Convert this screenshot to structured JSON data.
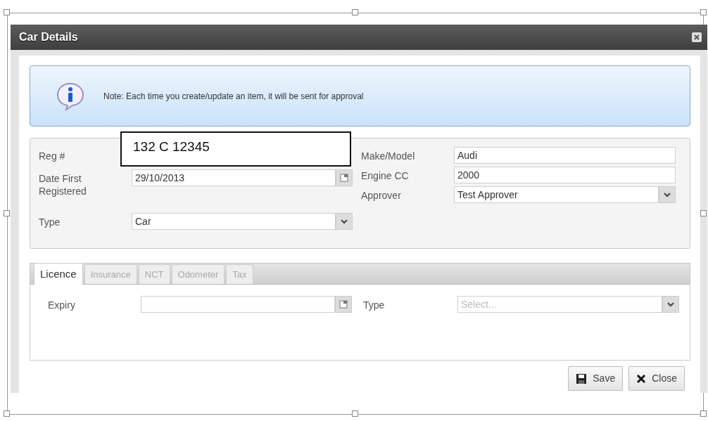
{
  "window": {
    "title": "Car Details"
  },
  "note": {
    "text": "Note: Each time you create/update an item, it will be sent for approval"
  },
  "fields_left": [
    {
      "kind": "text",
      "label": "Reg #",
      "value": "132 C 12345"
    },
    {
      "kind": "date",
      "label": "Date First Registered",
      "value": "29/10/2013"
    },
    {
      "kind": "select",
      "label": "Type",
      "value": "Car"
    }
  ],
  "fields_right": [
    {
      "kind": "text",
      "label": "Make/Model",
      "value": "Audi"
    },
    {
      "kind": "text",
      "label": "Engine CC",
      "value": "2000"
    },
    {
      "kind": "select",
      "label": "Approver",
      "value": "Test Approver"
    }
  ],
  "tabs": [
    {
      "label": "Licence",
      "selected": true
    },
    {
      "label": "Insurance",
      "selected": false
    },
    {
      "label": "NCT",
      "selected": false
    },
    {
      "label": "Odometer",
      "selected": false
    },
    {
      "label": "Tax",
      "selected": false
    }
  ],
  "tab_fields": [
    {
      "kind": "date",
      "label": "Expiry"
    },
    {
      "kind": "select",
      "label": "Type",
      "placeholder": "Select..."
    }
  ],
  "buttons": [
    {
      "kind": "save",
      "label": "Save"
    },
    {
      "kind": "close",
      "label": "Close"
    }
  ]
}
